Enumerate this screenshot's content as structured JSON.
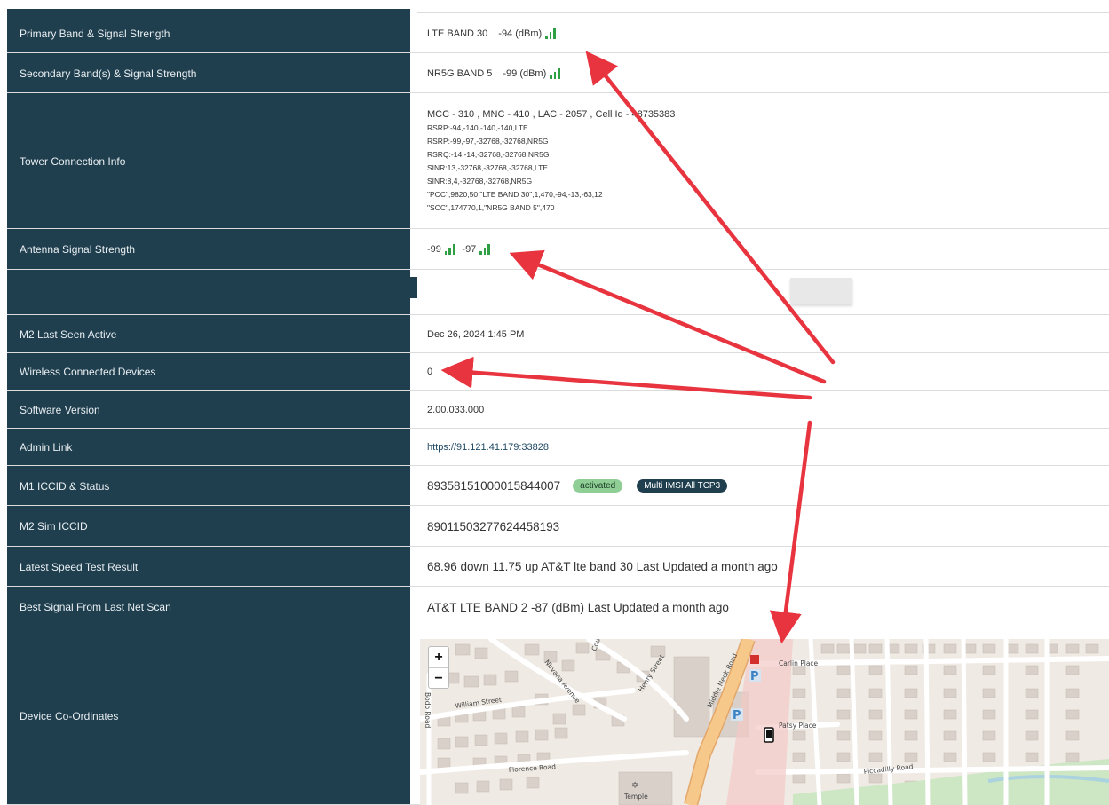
{
  "rows": {
    "primary_band": {
      "label": "Primary Band & Signal Strength",
      "band": "LTE BAND 30",
      "strength": "-94 (dBm)"
    },
    "secondary_band": {
      "label": "Secondary Band(s) & Signal Strength",
      "band": "NR5G BAND 5",
      "strength": "-99 (dBm)"
    },
    "tower": {
      "label": "Tower Connection Info",
      "main": "MCC - 310 , MNC - 410 , LAC - 2057 , Cell Id - 48735383",
      "lines": [
        "RSRP:-94,-140,-140,-140,LTE",
        "RSRP:-99,-97,-32768,-32768,NR5G",
        "RSRQ:-14,-14,-32768,-32768,NR5G",
        "SINR:13,-32768,-32768,-32768,LTE",
        "SINR:8,4,-32768,-32768,NR5G",
        "\"PCC\",9820,50,\"LTE BAND 30\",1,470,-94,-13,-63,12",
        "\"SCC\",174770,1,\"NR5G BAND 5\",470"
      ]
    },
    "antenna": {
      "label": "Antenna Signal Strength",
      "a1": "-99",
      "a2": "-97"
    },
    "m2_last_seen": {
      "label": "M2 Last Seen Active",
      "value": "Dec 26, 2024 1:45 PM"
    },
    "wireless": {
      "label": "Wireless Connected Devices",
      "value": "0"
    },
    "software": {
      "label": "Software Version",
      "value": "2.00.033.000"
    },
    "admin": {
      "label": "Admin Link",
      "value": "https://91.121.41.179:33828"
    },
    "m1_iccid": {
      "label": "M1 ICCID & Status",
      "value": "89358151000015844007",
      "status": "activated",
      "plan": "Multi IMSI All TCP3"
    },
    "m2_sim": {
      "label": "M2 Sim ICCID",
      "value": "89011503277624458193"
    },
    "speed": {
      "label": "Latest Speed Test Result",
      "value": "68.96 down 11.75 up AT&T lte band 30 Last Updated a month ago"
    },
    "best_signal": {
      "label": "Best Signal From Last Net Scan",
      "value": "AT&T LTE BAND 2 -87 (dBm) Last Updated a month ago"
    },
    "coords": {
      "label": "Device Co-Ordinates"
    }
  },
  "map": {
    "zoom_in": "+",
    "zoom_out": "−",
    "streets": {
      "william": "William Street",
      "nirvana": "Nirvana Avenue",
      "henry": "Henry Street",
      "middle_neck": "Middle Neck Road",
      "carlin": "Carlin Place",
      "patsy": "Patsy Place",
      "florence": "Florence Road",
      "piccadilly": "Piccadilly Road",
      "temple": "Temple",
      "bodo": "Bodo Road",
      "court": "Court Street"
    },
    "parking": "P",
    "colors": {
      "arrow": "#e8343f",
      "main_road": "#f6c98b",
      "park": "#cde6c4"
    }
  },
  "colors": {
    "label_bg": "#1f3e4e",
    "signal_green": "#2ea043",
    "badge_active": "#8fce94"
  }
}
